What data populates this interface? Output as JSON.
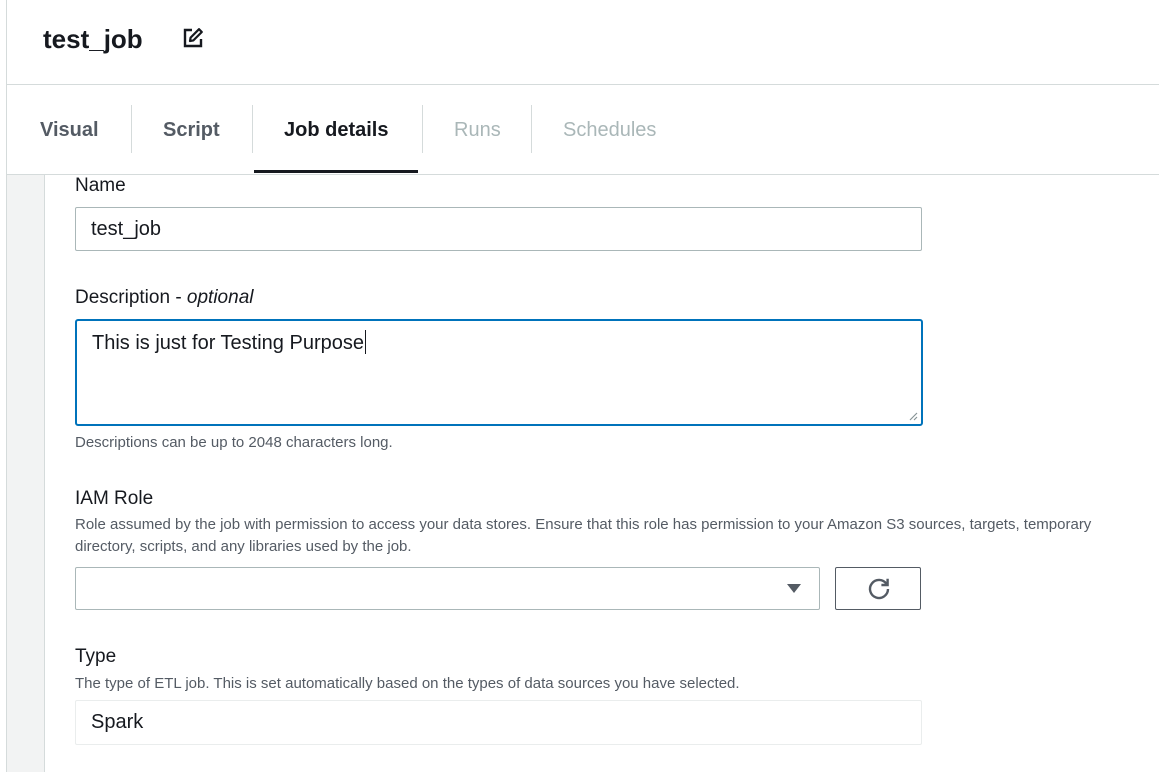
{
  "job": {
    "title": "test_job"
  },
  "tabs": [
    {
      "label": "Visual",
      "state": "normal"
    },
    {
      "label": "Script",
      "state": "normal"
    },
    {
      "label": "Job details",
      "state": "active"
    },
    {
      "label": "Runs",
      "state": "disabled"
    },
    {
      "label": "Schedules",
      "state": "disabled"
    }
  ],
  "form": {
    "name": {
      "label": "Name",
      "value": "test_job"
    },
    "description": {
      "label": "Description - ",
      "optional": "optional",
      "value": "This is just for Testing Purpose",
      "hint": "Descriptions can be up to 2048 characters long."
    },
    "iam_role": {
      "label": "IAM Role",
      "hint": "Role assumed by the job with permission to access your data stores. Ensure that this role has permission to your Amazon S3 sources, targets, temporary directory, scripts, and any libraries used by the job.",
      "value": ""
    },
    "type": {
      "label": "Type",
      "hint": "The type of ETL job. This is set automatically based on the types of data sources you have selected.",
      "value": "Spark"
    }
  },
  "icons": {
    "edit": "edit-icon",
    "dropdown": "caret-down-icon",
    "refresh": "refresh-icon",
    "resize": "resize-handle-icon"
  },
  "colors": {
    "focus_border": "#0073bb",
    "text": "#16191f",
    "muted": "#545b64",
    "disabled": "#aab7b8"
  }
}
